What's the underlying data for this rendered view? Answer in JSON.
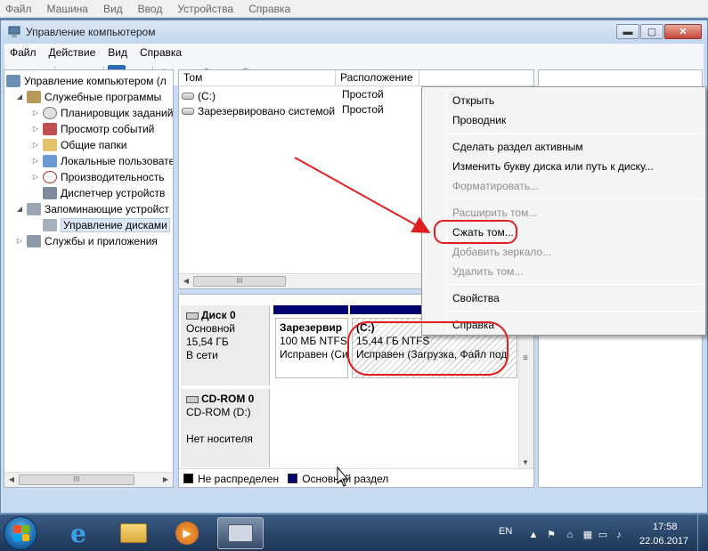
{
  "host_menu": [
    "Файл",
    "Машина",
    "Вид",
    "Ввод",
    "Устройства",
    "Справка"
  ],
  "window": {
    "title": "Управление компьютером",
    "minimize": "▬",
    "maximize": "▢",
    "close": "✕"
  },
  "menubar": [
    "Файл",
    "Действие",
    "Вид",
    "Справка"
  ],
  "toolbar": {
    "back": "◀",
    "forward": "▶",
    "up": "↑",
    "console_tree": "▥",
    "help": "?",
    "properties": "▤",
    "refresh": "⟳",
    "delete": "✕",
    "settings": "⚙",
    "open": "📂",
    "search": "🔍",
    "export": "▦"
  },
  "tree": {
    "root": "Управление компьютером (л",
    "system_tools": "Служебные программы",
    "task_scheduler": "Планировщик заданий",
    "event_viewer": "Просмотр событий",
    "shared_folders": "Общие папки",
    "local_users": "Локальные пользовате",
    "performance": "Производительность",
    "device_manager": "Диспетчер устройств",
    "storage": "Запоминающие устройст",
    "disk_management": "Управление дисками",
    "services_apps": "Службы и приложения"
  },
  "volumes": {
    "headers": [
      "Том",
      "Расположение"
    ],
    "rows": [
      {
        "name": "(C:)",
        "layout": "Простой"
      },
      {
        "name": "Зарезервировано системой",
        "layout": "Простой"
      }
    ],
    "scroll_thumb": "III"
  },
  "disks": {
    "disk0": {
      "name": "Диск 0",
      "type": "Основной",
      "size": "15,54 ГБ",
      "status": "В сети",
      "partitions": [
        {
          "name": "Зарезервир",
          "size": "100 МБ NTFS",
          "status": "Исправен (Си"
        },
        {
          "name": "(C:)",
          "size": "15,44 ГБ NTFS",
          "status": "Исправен (Загрузка, Файл под"
        }
      ]
    },
    "cdrom0": {
      "name": "CD-ROM 0",
      "drive": "CD-ROM (D:)",
      "media": "Нет носителя"
    }
  },
  "legend": [
    {
      "label": "Не распределен",
      "color": "#000000"
    },
    {
      "label": "Основной раздел",
      "color": "#00006e"
    }
  ],
  "context_menu": [
    {
      "label": "Открыть",
      "enabled": true
    },
    {
      "label": "Проводник",
      "enabled": true
    },
    {
      "label": "Сделать раздел активным",
      "enabled": true
    },
    {
      "label": "Изменить букву диска или путь к диску...",
      "enabled": true
    },
    {
      "label": "Форматировать...",
      "enabled": false
    },
    {
      "label": "Расширить том...",
      "enabled": false
    },
    {
      "label": "Сжать том...",
      "enabled": true
    },
    {
      "label": "Добавить зеркало...",
      "enabled": false
    },
    {
      "label": "Удалить том...",
      "enabled": false
    },
    {
      "label": "Свойства",
      "enabled": true
    },
    {
      "label": "Справка",
      "enabled": true
    }
  ],
  "annotation_color": "#e02020",
  "taskbar": {
    "language": "EN",
    "time": "17:58",
    "date": "22.06.2017"
  }
}
